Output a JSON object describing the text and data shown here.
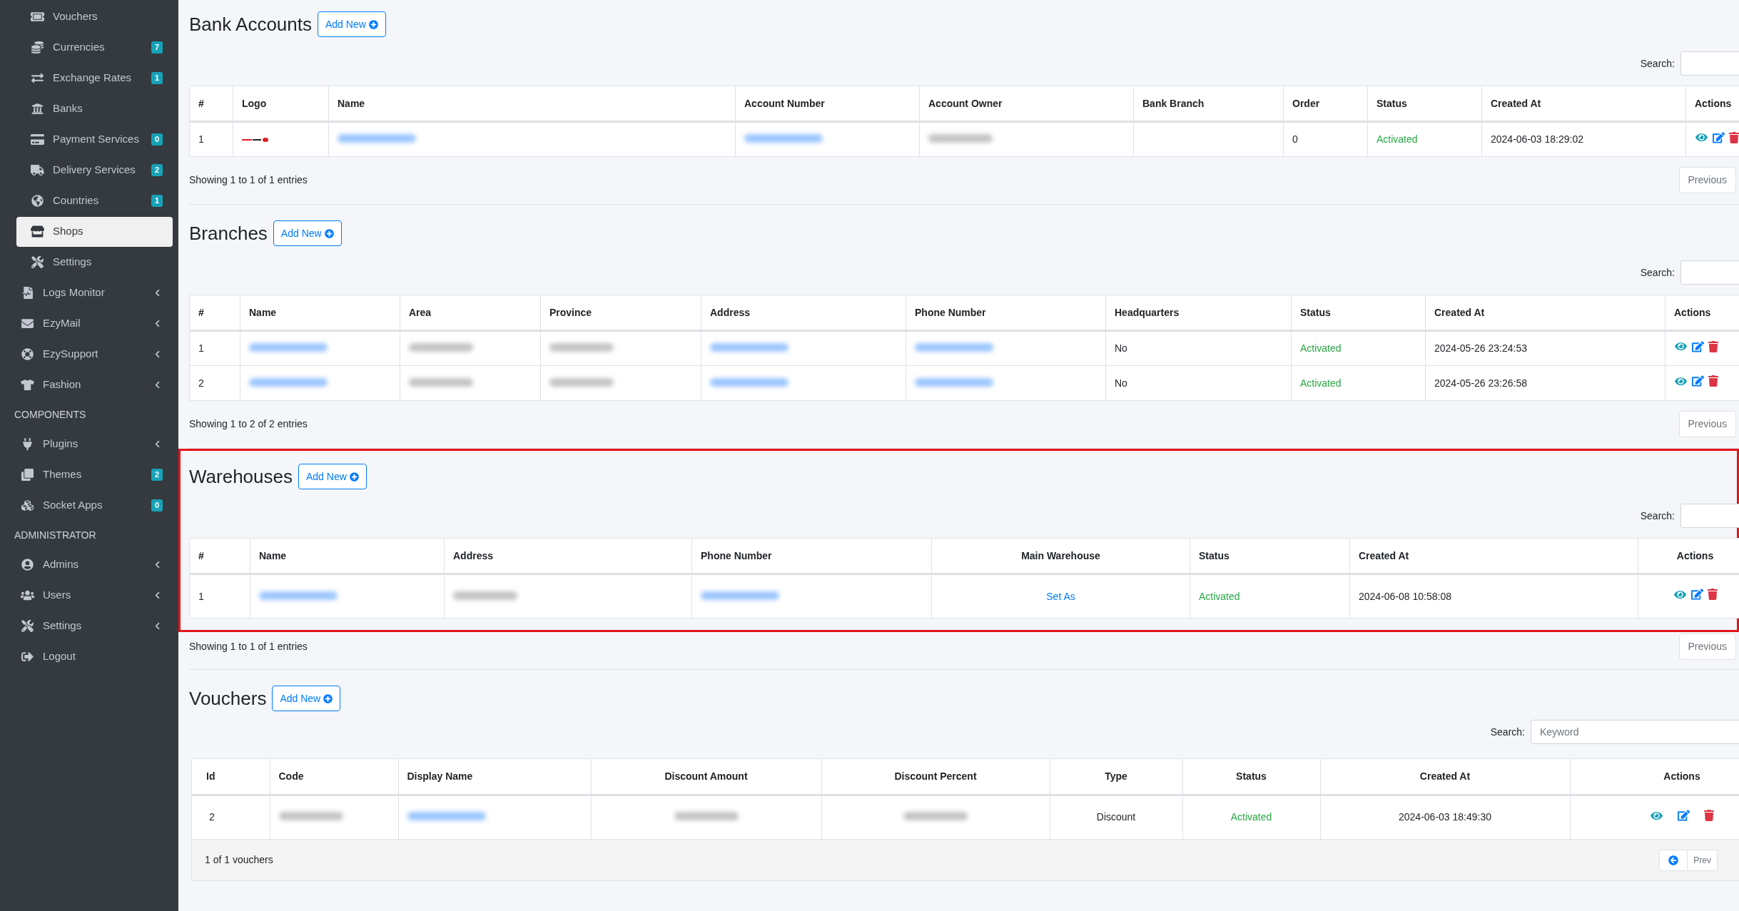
{
  "sidebar": {
    "items": [
      {
        "kind": "sub",
        "label": "Vouchers",
        "selected": false
      },
      {
        "kind": "sub",
        "label": "Currencies",
        "badge": "7",
        "selected": false
      },
      {
        "kind": "sub",
        "label": "Exchange Rates",
        "badge": "1",
        "selected": false
      },
      {
        "kind": "sub",
        "label": "Banks",
        "selected": false
      },
      {
        "kind": "sub",
        "label": "Payment Services",
        "badge": "0",
        "selected": false
      },
      {
        "kind": "sub",
        "label": "Delivery Services",
        "badge": "2",
        "selected": false
      },
      {
        "kind": "sub",
        "label": "Countries",
        "badge": "1",
        "selected": false
      },
      {
        "kind": "sub",
        "label": "Shops",
        "selected": true
      },
      {
        "kind": "sub",
        "label": "Settings",
        "selected": false
      },
      {
        "kind": "top",
        "label": "Logs Monitor",
        "expanded": false,
        "selected": false
      },
      {
        "kind": "top",
        "label": "EzyMail",
        "expanded": false,
        "selected": false
      },
      {
        "kind": "top",
        "label": "EzySupport",
        "expanded": false,
        "selected": false
      },
      {
        "kind": "top",
        "label": "Fashion",
        "expanded": false,
        "selected": false
      },
      {
        "kind": "header",
        "label": "COMPONENTS"
      },
      {
        "kind": "top",
        "label": "Plugins",
        "expanded": false,
        "selected": false
      },
      {
        "kind": "top",
        "label": "Themes",
        "badge": "2",
        "selected": false
      },
      {
        "kind": "top",
        "label": "Socket Apps",
        "badge": "0",
        "selected": false
      },
      {
        "kind": "header",
        "label": "ADMINISTRATOR"
      },
      {
        "kind": "top",
        "label": "Admins",
        "expanded": false,
        "selected": false
      },
      {
        "kind": "top",
        "label": "Users",
        "expanded": false,
        "selected": false
      },
      {
        "kind": "top",
        "label": "Settings",
        "expanded": false,
        "selected": false
      },
      {
        "kind": "top",
        "label": "Logout",
        "selected": false
      }
    ]
  },
  "sections": [
    {
      "title": "Bank Accounts",
      "add_button": "Add New",
      "highlighted": false,
      "search_label": "Search:",
      "columns": [
        "#",
        "Logo",
        "Name",
        "Account Number",
        "Account Owner",
        "Bank Branch",
        "Order",
        "Status",
        "Created At",
        "Actions"
      ],
      "rows": [
        [
          {
            "kind": "text",
            "text": "1"
          },
          {
            "kind": "logo"
          },
          {
            "kind": "redacted",
            "link": true
          },
          {
            "kind": "redacted",
            "link": true
          },
          {
            "kind": "redacted",
            "link": false
          },
          {
            "kind": "empty"
          },
          {
            "kind": "text",
            "text": "0"
          },
          {
            "kind": "status",
            "text": "Activated"
          },
          {
            "kind": "text",
            "text": "2024-06-03 18:29:02"
          },
          {
            "kind": "actions"
          }
        ]
      ],
      "info": "Showing 1 to 1 of 1 entries",
      "pager": [
        "Previous"
      ]
    },
    {
      "title": "Branches",
      "add_button": "Add New",
      "highlighted": false,
      "search_label": "Search:",
      "columns": [
        "#",
        "Name",
        "Area",
        "Province",
        "Address",
        "Phone Number",
        "Headquarters",
        "Status",
        "Created At",
        "Actions"
      ],
      "rows": [
        [
          {
            "kind": "text",
            "text": "1"
          },
          {
            "kind": "redacted",
            "link": true
          },
          {
            "kind": "redacted",
            "link": false
          },
          {
            "kind": "redacted",
            "link": false
          },
          {
            "kind": "redacted",
            "link": true
          },
          {
            "kind": "redacted",
            "link": true
          },
          {
            "kind": "text",
            "text": "No"
          },
          {
            "kind": "status",
            "text": "Activated"
          },
          {
            "kind": "text",
            "text": "2024-05-26 23:24:53"
          },
          {
            "kind": "actions"
          }
        ],
        [
          {
            "kind": "text",
            "text": "2"
          },
          {
            "kind": "redacted",
            "link": true
          },
          {
            "kind": "redacted",
            "link": false
          },
          {
            "kind": "redacted",
            "link": false
          },
          {
            "kind": "redacted",
            "link": true
          },
          {
            "kind": "redacted",
            "link": true
          },
          {
            "kind": "text",
            "text": "No"
          },
          {
            "kind": "status",
            "text": "Activated"
          },
          {
            "kind": "text",
            "text": "2024-05-26 23:26:58"
          },
          {
            "kind": "actions"
          }
        ]
      ],
      "info": "Showing 1 to 2 of 2 entries",
      "pager": [
        "Previous"
      ]
    },
    {
      "title": "Warehouses",
      "add_button": "Add New",
      "highlighted": true,
      "search_label": "Search:",
      "columns": [
        "#",
        "Name",
        "Address",
        "Phone Number",
        "Main Warehouse",
        "Status",
        "Created At",
        "Actions"
      ],
      "rows": [
        [
          {
            "kind": "text",
            "text": "1"
          },
          {
            "kind": "redacted",
            "link": true
          },
          {
            "kind": "redacted",
            "link": false
          },
          {
            "kind": "redacted",
            "link": true
          },
          {
            "kind": "link",
            "text": "Set As"
          },
          {
            "kind": "status",
            "text": "Activated"
          },
          {
            "kind": "text",
            "text": "2024-06-08 10:58:08"
          },
          {
            "kind": "actions"
          }
        ]
      ],
      "info": "Showing 1 to 1 of 1 entries",
      "pager": [
        "Previous"
      ]
    },
    {
      "title": "Vouchers",
      "add_button": "Add New",
      "highlighted": false,
      "search_label": "Search:",
      "search_placeholder": "Keyword",
      "columns": [
        "Id",
        "Code",
        "Display Name",
        "Discount Amount",
        "Discount Percent",
        "Type",
        "Status",
        "Created At",
        "Actions"
      ],
      "rows": [
        [
          {
            "kind": "text",
            "text": "2"
          },
          {
            "kind": "redacted",
            "link": false
          },
          {
            "kind": "redacted",
            "link": true
          },
          {
            "kind": "redacted",
            "link": false
          },
          {
            "kind": "redacted",
            "link": false
          },
          {
            "kind": "text",
            "text": "Discount"
          },
          {
            "kind": "status",
            "text": "Activated"
          },
          {
            "kind": "text",
            "text": "2024-06-03 18:49:30"
          },
          {
            "kind": "actions"
          }
        ]
      ],
      "info": "1 of 1 vouchers",
      "pager": [
        "Prev"
      ]
    }
  ]
}
